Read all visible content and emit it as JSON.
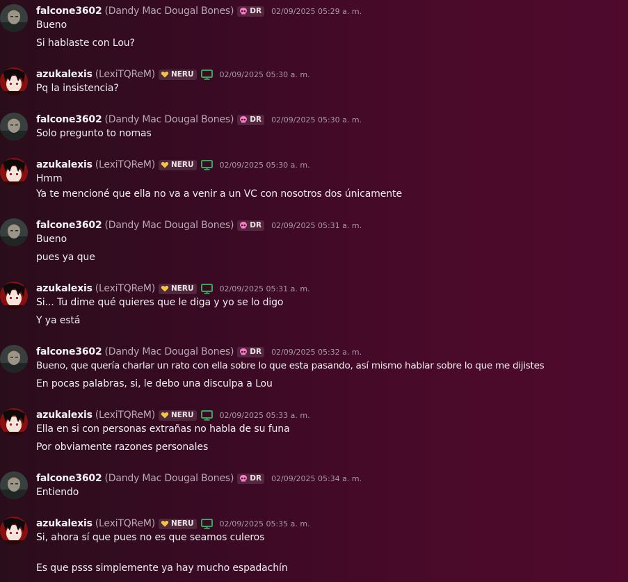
{
  "messages": [
    {
      "user": "falcone3602",
      "nick": "(Dandy Mac Dougal Bones)",
      "tag": "DR",
      "time": "02/09/2025 05:29 a. m.",
      "lines": [
        "Bueno",
        "Si hablaste con Lou?"
      ]
    },
    {
      "user": "azukalexis",
      "nick": "(LexiTQReM)",
      "tag": "NERU",
      "time": "02/09/2025 05:30 a. m.",
      "lines": [
        "Pq la insistencia?"
      ]
    },
    {
      "user": "falcone3602",
      "nick": "(Dandy Mac Dougal Bones)",
      "tag": "DR",
      "time": "02/09/2025 05:30 a. m.",
      "lines": [
        "Solo pregunto to nomas"
      ]
    },
    {
      "user": "azukalexis",
      "nick": "(LexiTQReM)",
      "tag": "NERU",
      "time": "02/09/2025 05:30 a. m.",
      "lines": [
        "Hmm",
        "Ya te mencioné que ella no va a venir a un VC con nosotros dos únicamente"
      ]
    },
    {
      "user": "falcone3602",
      "nick": "(Dandy Mac Dougal Bones)",
      "tag": "DR",
      "time": "02/09/2025 05:31 a. m.",
      "lines": [
        "Bueno",
        "pues ya que"
      ]
    },
    {
      "user": "azukalexis",
      "nick": "(LexiTQReM)",
      "tag": "NERU",
      "time": "02/09/2025 05:31 a. m.",
      "lines": [
        "Si... Tu dime qué quieres que le diga y yo se lo digo",
        "Y ya está"
      ]
    },
    {
      "user": "falcone3602",
      "nick": "(Dandy Mac Dougal Bones)",
      "tag": "DR",
      "time": "02/09/2025 05:32 a. m.",
      "lines": [
        "Bueno, que quería charlar un rato con ella sobre lo que esta pasando, así mismo hablar sobre lo que me dijistes",
        "En pocas palabras, si, le debo una disculpa a Lou"
      ]
    },
    {
      "user": "azukalexis",
      "nick": "(LexiTQReM)",
      "tag": "NERU",
      "time": "02/09/2025 05:33 a. m.",
      "lines": [
        "Ella en si con personas extrañas no habla de su funa",
        "Por obviamente razones personales"
      ]
    },
    {
      "user": "falcone3602",
      "nick": "(Dandy Mac Dougal Bones)",
      "tag": "DR",
      "time": "02/09/2025 05:34 a. m.",
      "lines": [
        "Entiendo"
      ]
    },
    {
      "user": "azukalexis",
      "nick": "(LexiTQReM)",
      "tag": "NERU",
      "time": "02/09/2025 05:35 a. m.",
      "lines": [
        "Si, ahora sí que pues no es que seamos culeros",
        "",
        "Es que psss simplemente ya hay mucho espadachín"
      ]
    }
  ],
  "colors": {
    "tag_dr_icon": "#ff7ac8",
    "tag_neru_icon": "#f5c542",
    "monitor_icon": "#3ba55c"
  }
}
